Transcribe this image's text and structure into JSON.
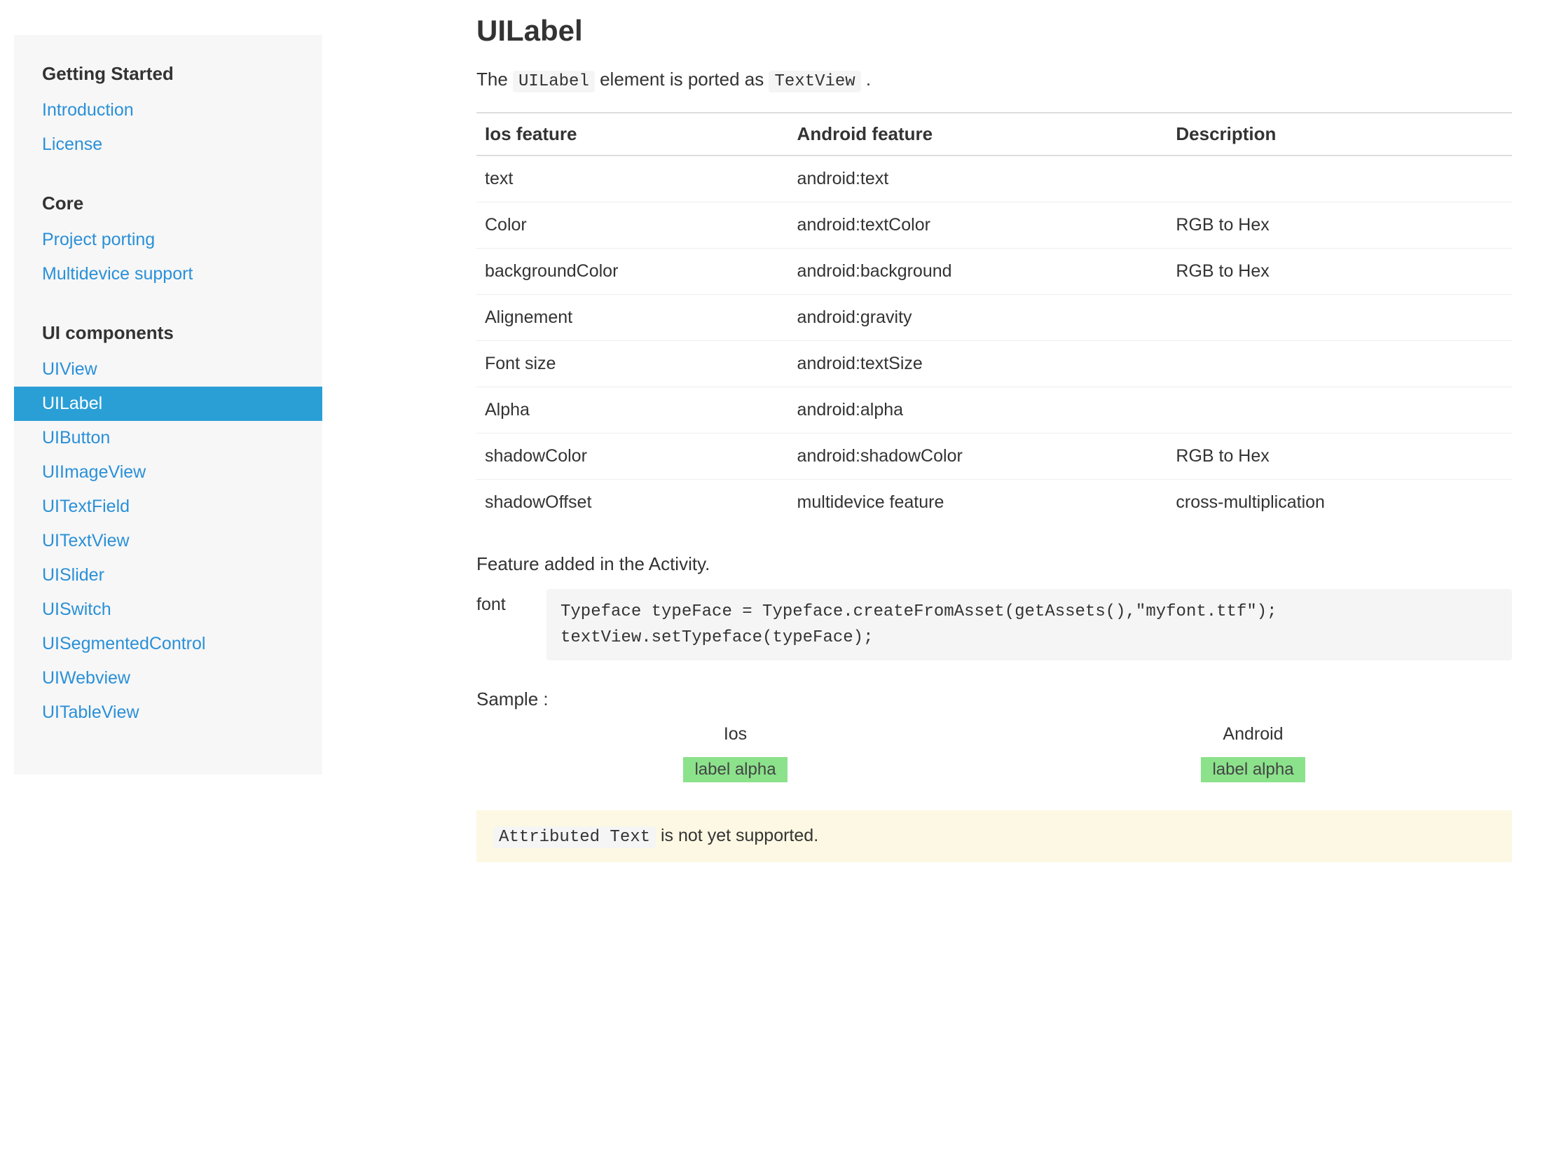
{
  "sidebar": {
    "sections": [
      {
        "heading": "Getting Started",
        "items": [
          {
            "label": "Introduction",
            "active": false
          },
          {
            "label": "License",
            "active": false
          }
        ]
      },
      {
        "heading": "Core",
        "items": [
          {
            "label": "Project porting",
            "active": false
          },
          {
            "label": "Multidevice support",
            "active": false
          }
        ]
      },
      {
        "heading": "UI components",
        "items": [
          {
            "label": "UIView",
            "active": false
          },
          {
            "label": "UILabel",
            "active": true
          },
          {
            "label": "UIButton",
            "active": false
          },
          {
            "label": "UIImageView",
            "active": false
          },
          {
            "label": "UITextField",
            "active": false
          },
          {
            "label": "UITextView",
            "active": false
          },
          {
            "label": "UISlider",
            "active": false
          },
          {
            "label": "UISwitch",
            "active": false
          },
          {
            "label": "UISegmentedControl",
            "active": false
          },
          {
            "label": "UIWebview",
            "active": false
          },
          {
            "label": "UITableView",
            "active": false
          }
        ]
      }
    ]
  },
  "page": {
    "title": "UILabel",
    "intro_prefix": "The ",
    "intro_code1": "UILabel",
    "intro_mid": " element is ported as ",
    "intro_code2": "TextView",
    "intro_suffix": ".",
    "table": {
      "headers": [
        "Ios feature",
        "Android feature",
        "Description"
      ],
      "rows": [
        [
          "text",
          "android:text",
          ""
        ],
        [
          "Color",
          "android:textColor",
          "RGB to Hex"
        ],
        [
          "backgroundColor",
          "android:background",
          "RGB to Hex"
        ],
        [
          "Alignement",
          "android:gravity",
          ""
        ],
        [
          "Font size",
          "android:textSize",
          ""
        ],
        [
          "Alpha",
          "android:alpha",
          ""
        ],
        [
          "shadowColor",
          "android:shadowColor",
          "RGB to Hex"
        ],
        [
          "shadowOffset",
          "multidevice feature",
          "cross-multiplication"
        ]
      ]
    },
    "activity_para": "Feature added in the Activity.",
    "code_label": "font",
    "code_block": "Typeface typeFace = Typeface.createFromAsset(getAssets(),\"myfont.ttf\");\ntextView.setTypeface(typeFace);",
    "sample_label": "Sample :",
    "samples": [
      {
        "title": "Ios",
        "badge": "label alpha"
      },
      {
        "title": "Android",
        "badge": "label alpha"
      }
    ],
    "note_code": "Attributed Text",
    "note_suffix": " is not yet supported."
  }
}
